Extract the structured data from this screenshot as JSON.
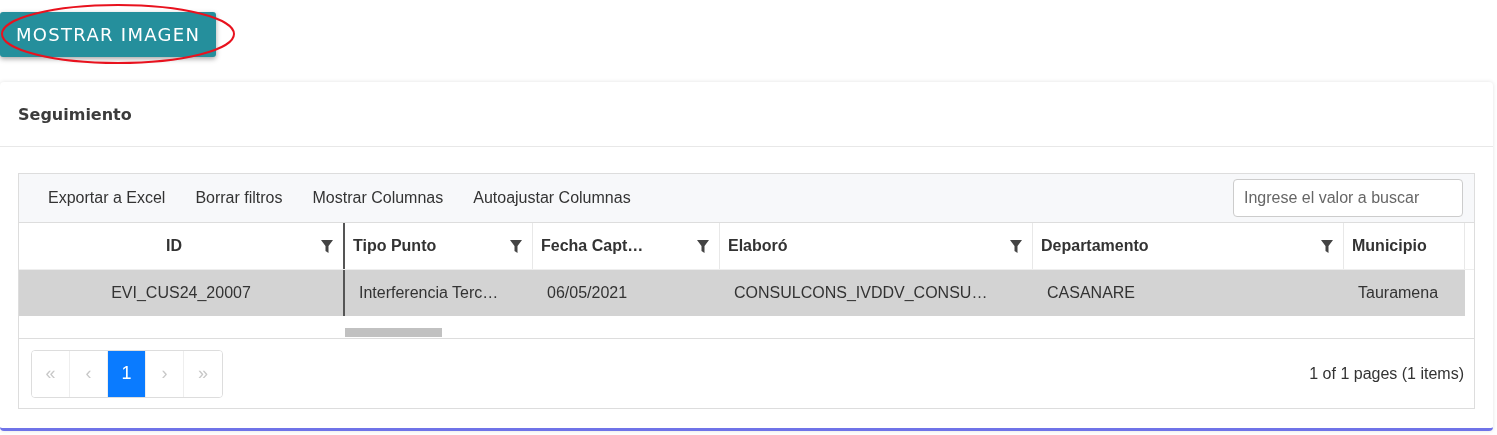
{
  "action_button": {
    "label": "MOSTRAR IMAGEN",
    "highlighted": true
  },
  "card": {
    "title": "Seguimiento"
  },
  "toolbar": {
    "items": [
      "Exportar a Excel",
      "Borrar filtros",
      "Mostrar Columnas",
      "Autoajustar Columnas"
    ],
    "search": {
      "placeholder": "Ingrese el valor a buscar"
    }
  },
  "table": {
    "columns": [
      {
        "label": "ID",
        "filter": true
      },
      {
        "label": "Tipo Punto",
        "filter": true
      },
      {
        "label": "Fecha Capt…",
        "filter": true
      },
      {
        "label": "Elaboró",
        "filter": true
      },
      {
        "label": "Departamento",
        "filter": true
      },
      {
        "label": "Municipio",
        "filter": false
      }
    ],
    "rows": [
      {
        "selected": true,
        "cells": [
          "EVI_CUS24_20007",
          "Interferencia Terc…",
          "06/05/2021",
          "CONSULCONS_IVDDV_CONSU…",
          "CASANARE",
          "Tauramena"
        ]
      }
    ]
  },
  "pager": {
    "buttons": [
      {
        "label": "«",
        "selected": false,
        "disabled": true
      },
      {
        "label": "‹",
        "selected": false,
        "disabled": true
      },
      {
        "label": "1",
        "selected": true,
        "disabled": false
      },
      {
        "label": "›",
        "selected": false,
        "disabled": true
      },
      {
        "label": "»",
        "selected": false,
        "disabled": true
      }
    ],
    "summary": "1 of 1 pages (1 items)"
  }
}
